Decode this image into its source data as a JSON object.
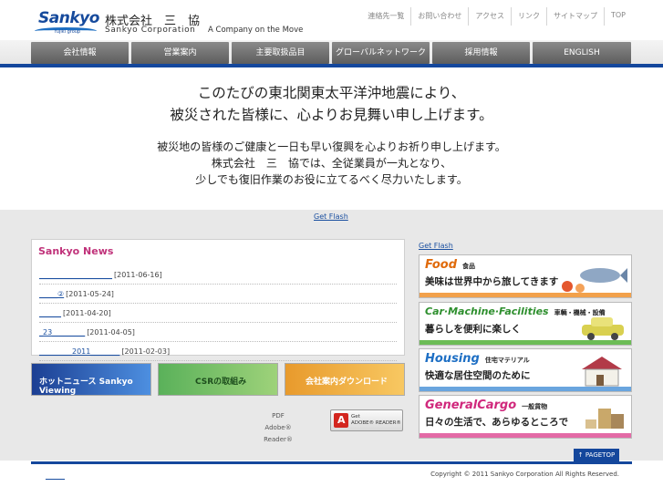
{
  "header": {
    "logo_text": "Sankyo",
    "logo_sub": "fujiki group",
    "company_jp": "株式会社　三　協",
    "company_en": "Sankyo Corporation",
    "tagline": "A Company on the Move"
  },
  "util_nav": [
    "連絡先一覧",
    "お問い合わせ",
    "アクセス",
    "リンク",
    "サイトマップ",
    "TOP"
  ],
  "main_nav": [
    "会社情報",
    "営業案内",
    "主要取扱品目",
    "グローバルネットワーク",
    "採用情報",
    "ENGLISH"
  ],
  "message": {
    "line1": "このたびの東北関東太平洋沖地震により、",
    "line2": "被災された皆様に、心よりお見舞い申し上げます。",
    "line3": "被災地の皆様のご健康と一日も早い復興を心よりお祈り申し上げます。",
    "line4": "株式会社　三　協では、全従業員が一丸となり、",
    "line5": "少しでも復旧作業のお役に立てるべく尽力いたします。"
  },
  "get_flash": "Get Flash",
  "news": {
    "title": "Sankyo News",
    "items": [
      {
        "link": "____________________",
        "date": "[2011-06-16]"
      },
      {
        "link": "_____②",
        "date": "[2011-05-24]"
      },
      {
        "link": "______",
        "date": "[2011-04-20]"
      },
      {
        "link": "_23_________",
        "date": "[2011-04-05]"
      },
      {
        "link": "_________2011________",
        "date": "[2011-02-03]"
      }
    ]
  },
  "banners": {
    "b1": "ホットニュース Sankyo Viewing",
    "b2": "CSRの取組み",
    "b3": "会社案内ダウンロード"
  },
  "pdf": {
    "line1": "PDF",
    "line2": "Adobe® Reader®",
    "button_line1": "Get",
    "button_line2": "ADOBE® READER®"
  },
  "categories": {
    "food": {
      "title": "Food",
      "jp": "食品",
      "copy": "美味は世界中から旅してきます"
    },
    "machinery": {
      "title": "Car·Machine·Facilities",
      "jp": "車輌・機械・設備",
      "copy": "暮らしを便利に楽しく"
    },
    "housing": {
      "title": "Housing",
      "jp": "住宅マテリアル",
      "copy": "快適な居住空間のために"
    },
    "cargo": {
      "title": "GeneralCargo",
      "jp": "一般貨物",
      "copy": "日々の生活で、あらゆるところで"
    }
  },
  "footer": {
    "pagetop": "↑ PAGETOP",
    "link": "______",
    "copyright": "Copyright © 2011 Sankyo Corporation All Rights Reserved."
  },
  "colors": {
    "brand_blue": "#14479c",
    "news_title": "#c0327a",
    "link": "#1a4fa0"
  }
}
